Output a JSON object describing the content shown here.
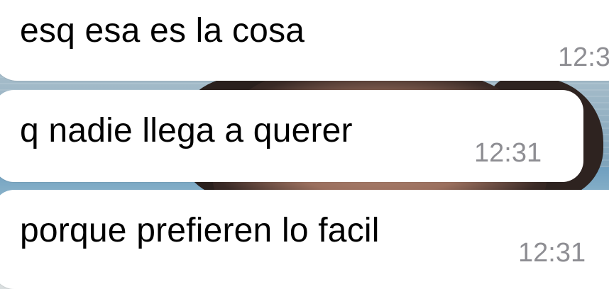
{
  "messages": [
    {
      "text": "esq esa es la cosa",
      "time": "12:3"
    },
    {
      "text": "q nadie llega a querer",
      "time": "12:31"
    },
    {
      "text": "porque prefieren lo facil",
      "time": "12:31"
    }
  ]
}
